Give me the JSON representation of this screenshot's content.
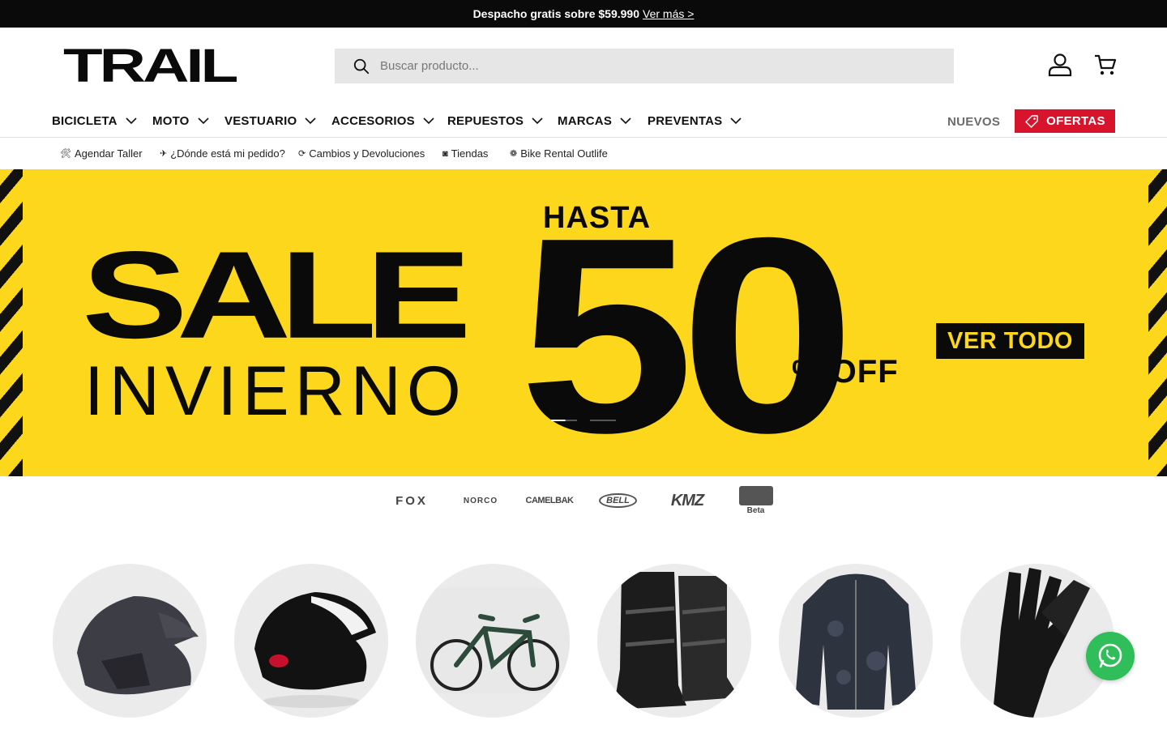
{
  "announcement": {
    "text": "Despacho gratis sobre $59.990",
    "link": "Ver más >"
  },
  "header": {
    "logo_text": "TRAIL",
    "search_placeholder": "Buscar producto...",
    "icons": [
      "search-icon",
      "account-icon",
      "cart-icon"
    ]
  },
  "nav": {
    "items": [
      {
        "label": "BICICLETA"
      },
      {
        "label": "MOTO"
      },
      {
        "label": "VESTUARIO"
      },
      {
        "label": "ACCESORIOS"
      },
      {
        "label": "REPUESTOS"
      },
      {
        "label": "MARCAS"
      },
      {
        "label": "PREVENTAS"
      }
    ],
    "nuevos": "NUEVOS",
    "ofertas": "OFERTAS"
  },
  "subnav": {
    "items": [
      {
        "icon": "🛠",
        "label": "Agendar Taller"
      },
      {
        "icon": "✈",
        "label": "¿Dónde está mi pedido?"
      },
      {
        "icon": "⟳",
        "label": "Cambios y Devoluciones"
      },
      {
        "icon": "◙",
        "label": "Tiendas"
      },
      {
        "icon": "❁",
        "label": "Bike Rental Outlife"
      }
    ]
  },
  "hero": {
    "line1": "SALE",
    "line2": "INVIERNO",
    "hasta": "HASTA",
    "number": "50",
    "off": "% OFF",
    "cta": "VER TODO",
    "slides_count": 2,
    "active_slide": 1,
    "colors": {
      "background": "#fdd71b",
      "text": "#0a0a0a"
    }
  },
  "brands": {
    "items": [
      {
        "label": "FOX"
      },
      {
        "label": "NORCO"
      },
      {
        "label": "CAMELBAK"
      },
      {
        "label": "BELL"
      },
      {
        "label": "KMZ"
      },
      {
        "label": "Beta"
      }
    ]
  },
  "categories": {
    "items": [
      "helmet-fox-image",
      "helmet-bell-image",
      "ebike-image",
      "boots-image",
      "jacket-image",
      "gloves-image"
    ]
  },
  "colors": {
    "ofertas": "#d8132c",
    "announcement_bg": "#0a0a0a",
    "whatsapp": "#2fbe5a"
  }
}
